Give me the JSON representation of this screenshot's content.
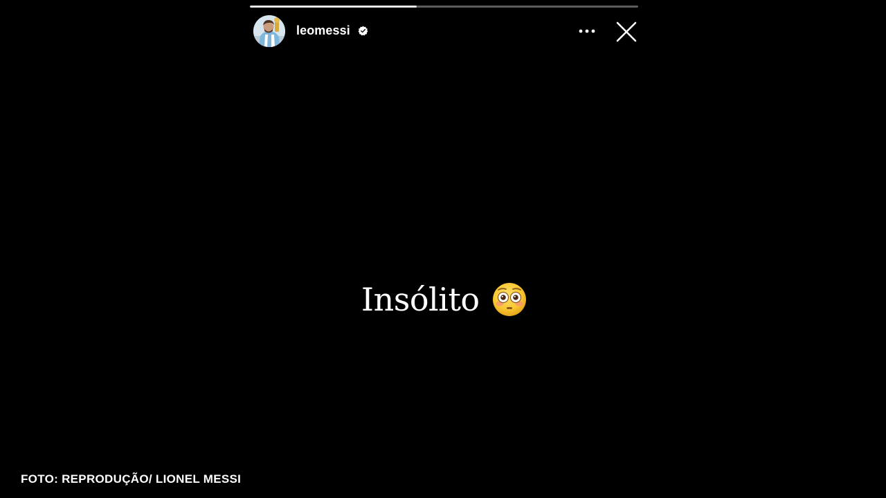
{
  "story": {
    "progress": 0.43,
    "username": "leomessi",
    "verified": true,
    "text": "Insólito",
    "emoji": "flushed-face-emoji",
    "icons": {
      "verified": "verified-badge-icon",
      "more": "more-options-icon",
      "close": "close-icon"
    },
    "colors": {
      "background": "#000000",
      "progress_track": "#5d5d5d",
      "progress_fill": "#e9e9e9",
      "text": "#ffffff"
    }
  },
  "caption": "FOTO: REPRODUÇÃO/ LIONEL MESSI"
}
